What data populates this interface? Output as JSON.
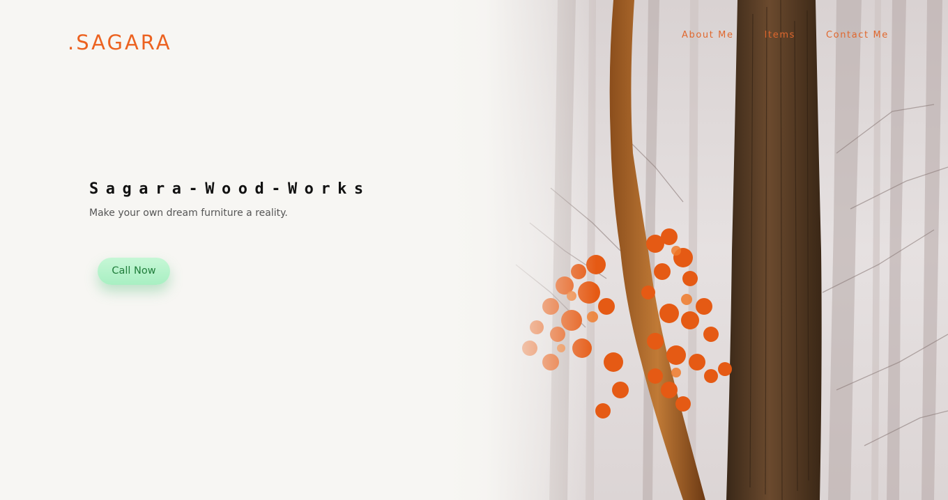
{
  "header": {
    "logo": ".SAGARA",
    "nav": [
      {
        "label": "About Me"
      },
      {
        "label": "Items"
      },
      {
        "label": "Contact Me"
      }
    ]
  },
  "hero": {
    "title": "Sagara-Wood-Works",
    "subtitle": "Make your own dream furniture a reality.",
    "cta_label": "Call Now",
    "image_subject": "foggy-forest-with-autumn-leaves"
  },
  "colors": {
    "accent": "#ec6220",
    "background": "#f7f6f3",
    "button_bg": "#b4f2cb",
    "button_text": "#1f7d3a"
  }
}
